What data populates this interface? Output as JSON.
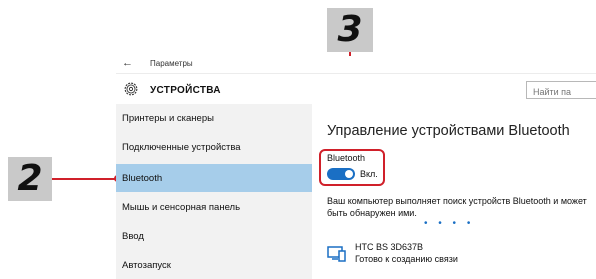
{
  "callouts": {
    "top_number": "3",
    "left_number": "2"
  },
  "window": {
    "app_title": "Параметры",
    "page_title": "УСТРОЙСТВА",
    "search_placeholder": "Найти па"
  },
  "sidebar": {
    "items": [
      {
        "label": "Принтеры и сканеры",
        "selected": false
      },
      {
        "label": "Подключенные устройства",
        "selected": false
      },
      {
        "label": "Bluetooth",
        "selected": true
      },
      {
        "label": "Мышь и сенсорная панель",
        "selected": false
      },
      {
        "label": "Ввод",
        "selected": false
      },
      {
        "label": "Автозапуск",
        "selected": false
      }
    ]
  },
  "main": {
    "title": "Управление устройствами Bluetooth",
    "bluetooth_label": "Bluetooth",
    "toggle_state": "Вкл.",
    "description": "Ваш компьютер выполняет поиск устройств Bluetooth и может быть обнаружен ими.",
    "progress_dots": "• • • •",
    "device": {
      "name": "HTC BS 3D637B",
      "status": "Готово к созданию связи"
    }
  },
  "colors": {
    "accent": "#1a6fc4",
    "selection": "#a6cdea",
    "callout": "#d0202a",
    "sidebar_bg": "#f2f2f2"
  },
  "icons": [
    "back-arrow-icon",
    "gear-icon",
    "device-icon"
  ]
}
